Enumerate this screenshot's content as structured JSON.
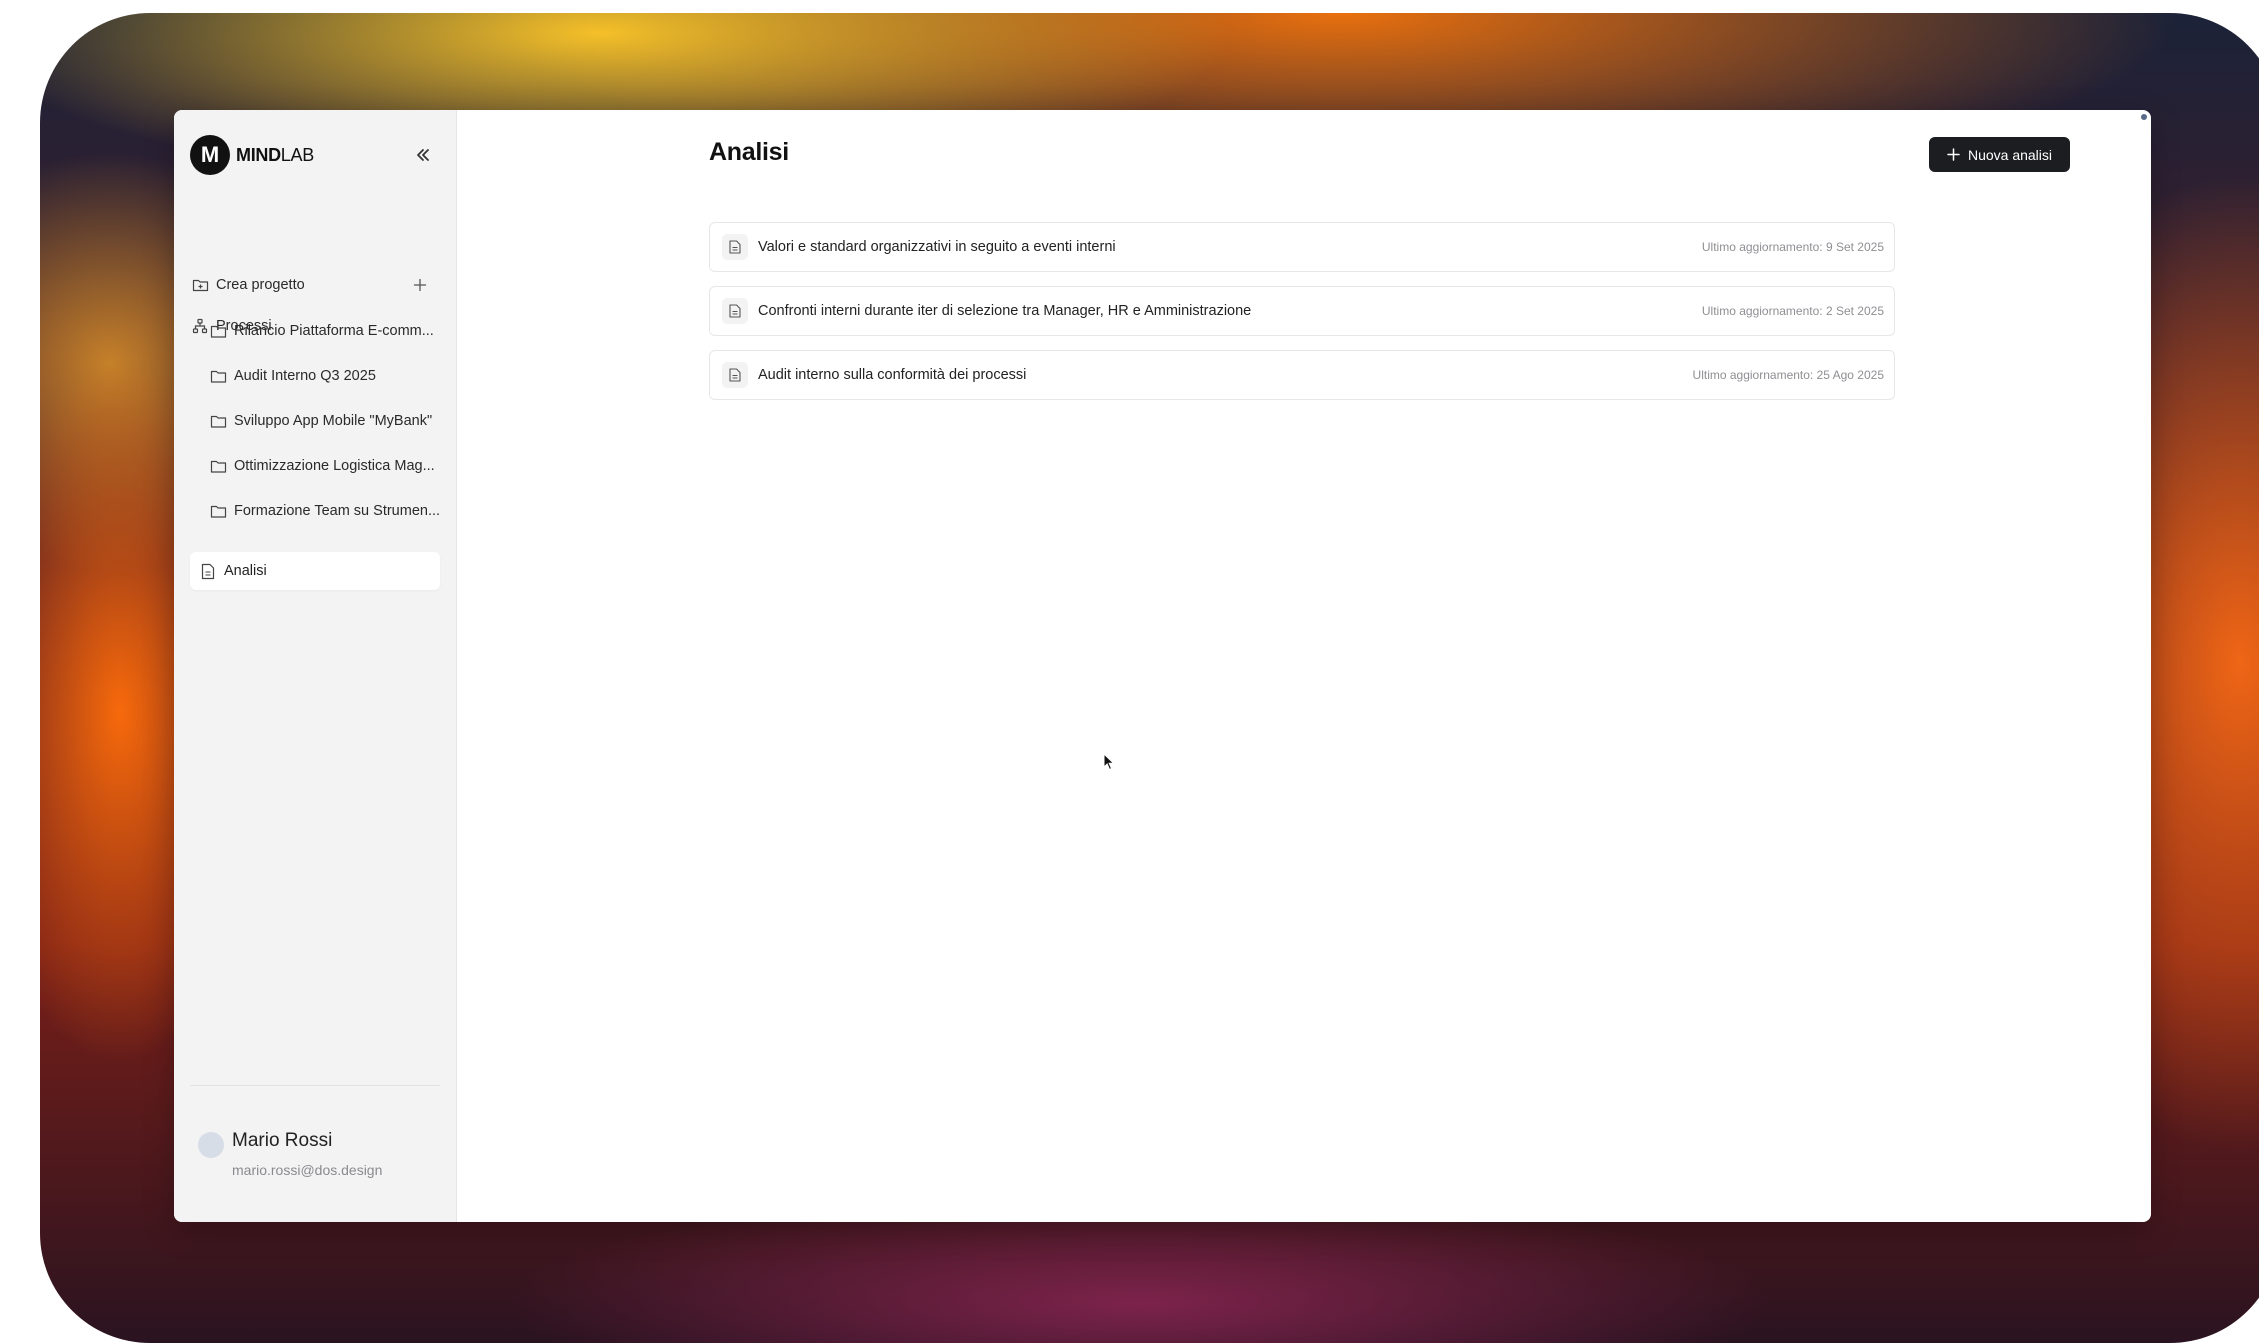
{
  "app": {
    "brand_initial": "M",
    "brand_bold": "MIND",
    "brand_light": "LAB"
  },
  "sidebar": {
    "collapse_icon": "double-chevron-left-icon",
    "processes_label": "Processi",
    "create_project_label": "Crea progetto",
    "projects": [
      {
        "label": "Rilancio Piattaforma E-comm..."
      },
      {
        "label": "Audit Interno Q3 2025"
      },
      {
        "label": "Sviluppo App Mobile \"MyBank\""
      },
      {
        "label": "Ottimizzazione Logistica Mag..."
      },
      {
        "label": "Formazione Team su Strumen..."
      }
    ],
    "active_item_label": "Analisi"
  },
  "user": {
    "name": "Mario Rossi",
    "email": "mario.rossi@dos.design"
  },
  "main": {
    "title": "Analisi",
    "new_button_label": "Nuova analisi",
    "analyses": [
      {
        "title": "Valori e standard organizzativi in seguito a eventi interni",
        "updated": "Ultimo aggiornamento: 9 Set 2025"
      },
      {
        "title": "Confronti interni durante iter di selezione tra Manager, HR e Amministrazione",
        "updated": "Ultimo aggiornamento: 2 Set 2025"
      },
      {
        "title": "Audit interno sulla conformità dei processi",
        "updated": "Ultimo aggiornamento: 25 Ago 2025"
      }
    ]
  },
  "colors": {
    "accent_dark": "#1c1d20",
    "sidebar_bg": "#f3f3f4",
    "muted_text": "#8f8f94"
  }
}
